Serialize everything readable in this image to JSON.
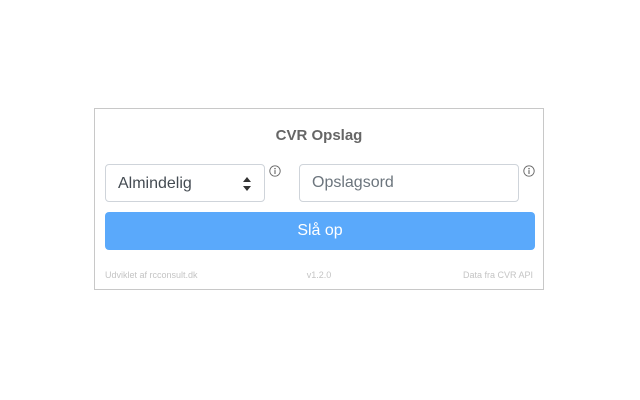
{
  "form": {
    "title": "CVR Opslag",
    "select_value": "Almindelig",
    "search_placeholder": "Opslagsord",
    "search_value": "",
    "submit_label": "Slå op"
  },
  "footer": {
    "credit": "Udviklet af rcconsult.dk",
    "version": "v1.2.0",
    "source": "Data fra CVR API"
  },
  "colors": {
    "button_bg": "#5aa9fb",
    "title_text": "#666666",
    "footer_text": "#c4c4c4"
  }
}
